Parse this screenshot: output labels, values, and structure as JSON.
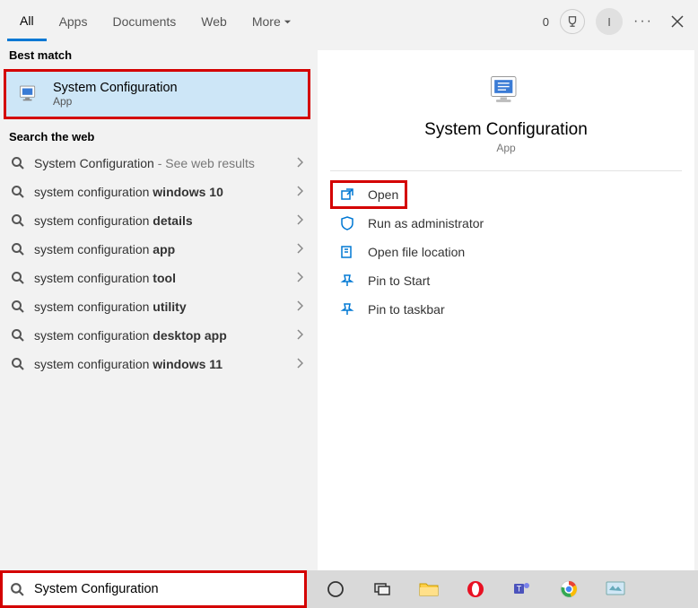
{
  "tabs": {
    "t0": "All",
    "t1": "Apps",
    "t2": "Documents",
    "t3": "Web",
    "more": "More"
  },
  "topbar": {
    "count": "0",
    "avatar": "I"
  },
  "labels": {
    "best_match": "Best match",
    "search_web": "Search the web"
  },
  "best": {
    "title": "System Configuration",
    "subtitle": "App"
  },
  "web": {
    "i0": {
      "pre": "System Configuration",
      "bold": "",
      "hint": " - See web results"
    },
    "i1": {
      "pre": "system configuration ",
      "bold": "windows 10",
      "hint": ""
    },
    "i2": {
      "pre": "system configuration ",
      "bold": "details",
      "hint": ""
    },
    "i3": {
      "pre": "system configuration ",
      "bold": "app",
      "hint": ""
    },
    "i4": {
      "pre": "system configuration ",
      "bold": "tool",
      "hint": ""
    },
    "i5": {
      "pre": "system configuration ",
      "bold": "utility",
      "hint": ""
    },
    "i6": {
      "pre": "system configuration ",
      "bold": "desktop app",
      "hint": ""
    },
    "i7": {
      "pre": "system configuration ",
      "bold": "windows 11",
      "hint": ""
    }
  },
  "detail": {
    "title": "System Configuration",
    "subtitle": "App"
  },
  "actions": {
    "open": "Open",
    "admin": "Run as administrator",
    "loc": "Open file location",
    "pin_start": "Pin to Start",
    "pin_task": "Pin to taskbar"
  },
  "search": {
    "value": "System Configuration"
  }
}
